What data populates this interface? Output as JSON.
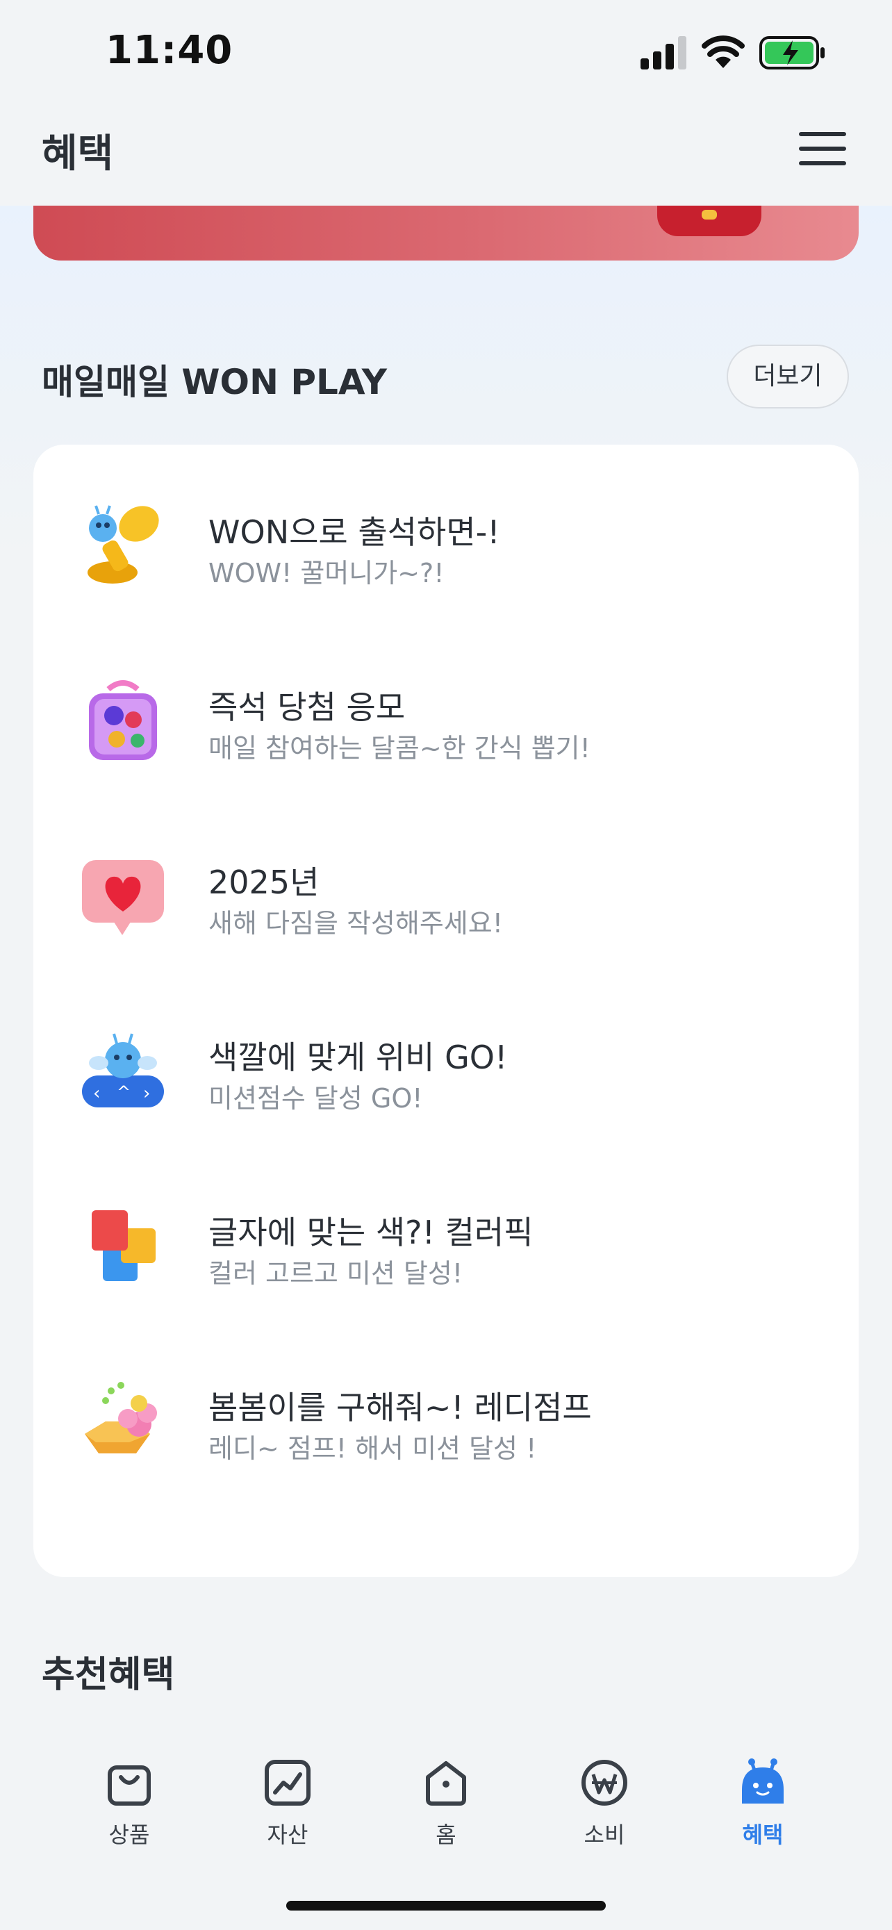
{
  "status_bar": {
    "time": "11:40"
  },
  "header": {
    "title": "혜택"
  },
  "won_play": {
    "title": "매일매일 WON PLAY",
    "more_label": "더보기",
    "items": [
      {
        "title": "WON으로 출석하면-!",
        "subtitle": "WOW! 꿀머니가~?!",
        "icon": "stamp-icon"
      },
      {
        "title": "즉석 당첨 응모",
        "subtitle": "매일 참여하는 달콤~한 간식 뽑기!",
        "icon": "candy-jar-icon"
      },
      {
        "title": "2025년",
        "subtitle": "새해 다짐을 작성해주세요!",
        "icon": "heart-bubble-icon"
      },
      {
        "title": "색깔에 맞게 위비 GO!",
        "subtitle": "미션점수 달성 GO!",
        "icon": "game-controller-icon"
      },
      {
        "title": "글자에 맞는 색?! 컬러픽",
        "subtitle": "컬러 고르고 미션 달성!",
        "icon": "color-blocks-icon"
      },
      {
        "title": "봄봄이를 구해줘~! 레디점프",
        "subtitle": "레디~ 점프! 해서 미션 달성 !",
        "icon": "jump-platform-icon"
      }
    ]
  },
  "recommended": {
    "title": "추천혜택"
  },
  "tab_bar": {
    "tabs": [
      {
        "label": "상품",
        "icon": "shopping-bag-icon",
        "active": false
      },
      {
        "label": "자산",
        "icon": "chart-icon",
        "active": false
      },
      {
        "label": "홈",
        "icon": "home-icon",
        "active": false
      },
      {
        "label": "소비",
        "icon": "won-coin-icon",
        "active": false
      },
      {
        "label": "혜택",
        "icon": "mascot-icon",
        "active": true
      }
    ]
  },
  "colors": {
    "accent": "#2f7ee9",
    "banner": "#d65a62",
    "text_primary": "#2a2f36",
    "text_secondary": "#8b929b",
    "battery": "#34c759"
  }
}
